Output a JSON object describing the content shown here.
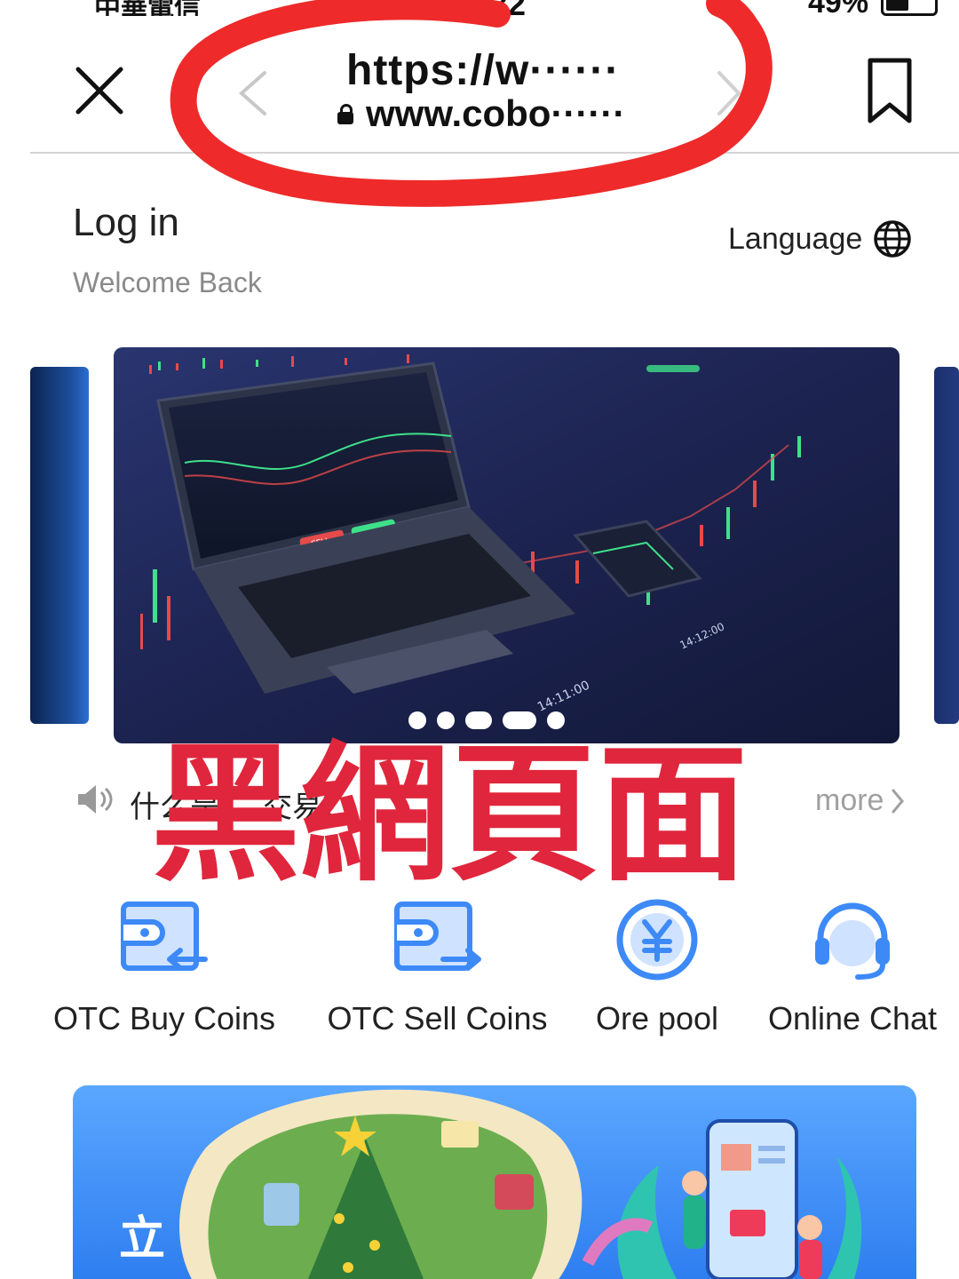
{
  "status_bar": {
    "carrier": "中華電信",
    "time": "19:32",
    "battery_percent": "49%",
    "battery_level": 0.49
  },
  "browser": {
    "url_main": "https://w······",
    "url_host": "www.cobo······",
    "icons": [
      "close-icon",
      "back-icon",
      "forward-icon",
      "lock-icon",
      "bookmark-icon"
    ]
  },
  "header": {
    "title": "Log in",
    "subtitle": "Welcome Back",
    "language_label": "Language",
    "language_icon": "globe-icon"
  },
  "carousel": {
    "slide_count": 5,
    "active_index": 3,
    "banner_texts": {
      "sell_button": "SELL",
      "time_1": "14:12:00",
      "time_2": "14:11:00"
    }
  },
  "announcement": {
    "icon": "speaker-icon",
    "text": "什么是 ... 交易？",
    "more_label": "more"
  },
  "overlay_annotation": {
    "text": "黑網頁面",
    "color": "#e0263c"
  },
  "quick_actions": [
    {
      "label": "OTC Buy Coins",
      "icon": "wallet-in-icon"
    },
    {
      "label": "OTC Sell Coins",
      "icon": "wallet-out-icon"
    },
    {
      "label": "Ore pool",
      "icon": "yen-coin-icon"
    },
    {
      "label": "Online Chat",
      "icon": "headset-icon"
    }
  ],
  "promo": {
    "text": "立 ..."
  },
  "colors": {
    "accent_blue": "#2f7ef0",
    "icon_blue": "#3d8af7",
    "annotation_red": "#e0263c",
    "text_gray": "#8a8a8a"
  }
}
